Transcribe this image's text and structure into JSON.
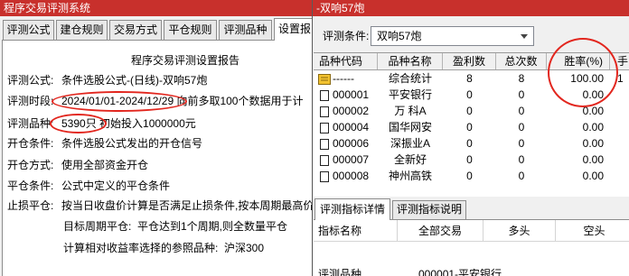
{
  "colors": {
    "title_bar": "#c8302c",
    "highlight_ring": "#e2261e",
    "folder_icon": "#f2c230"
  },
  "left_window": {
    "title": "程序交易评测系统",
    "tabs": [
      "评测公式",
      "建仓规则",
      "交易方式",
      "平仓规则",
      "评测品种",
      "设置报"
    ],
    "report": {
      "title": "程序交易评测设置报告",
      "rows": [
        {
          "label": "评测公式:",
          "value": "条件选股公式-(日线)-双响57炮"
        },
        {
          "label": "评测时段:",
          "value": "2024/01/01-2024/12/29 向前多取100个数据用于计"
        },
        {
          "label": "评测品种:",
          "value": "5390只 初始投入1000000元"
        },
        {
          "label": "开仓条件:",
          "value": "条件选股公式发出的开仓信号"
        },
        {
          "label": "开仓方式:",
          "value": "使用全部资金开仓"
        },
        {
          "label": "平仓条件:",
          "value": "公式中定义的平仓条件"
        },
        {
          "label": "止损平仓:",
          "value": "按当日收盘价计算是否满足止损条件,按本周期最高价"
        }
      ],
      "sub_rows": [
        {
          "label": "目标周期平仓:",
          "value": "平仓达到1个周期,则全数量平仓"
        },
        {
          "label": "计算相对收益率选择的参照品种:",
          "value": "沪深300"
        }
      ]
    }
  },
  "right_window": {
    "title": "-双响57炮",
    "condition_label": "评测条件:",
    "condition_value": "双响57炮",
    "table": {
      "columns": [
        "品种代码",
        "品种名称",
        "盈利数",
        "总次数",
        "胜率(%)",
        "手"
      ],
      "rows": [
        {
          "icon": "folder-icon",
          "code": "------",
          "name": "综合统计",
          "wins": "8",
          "total": "8",
          "win_rate": "100.00",
          "extra": "1"
        },
        {
          "icon": "document-icon",
          "code": "000001",
          "name": "平安银行",
          "wins": "0",
          "total": "0",
          "win_rate": "0.00"
        },
        {
          "icon": "document-icon",
          "code": "000002",
          "name": "万 科A",
          "wins": "0",
          "total": "0",
          "win_rate": "0.00"
        },
        {
          "icon": "document-icon",
          "code": "000004",
          "name": "国华网安",
          "wins": "0",
          "total": "0",
          "win_rate": "0.00"
        },
        {
          "icon": "document-icon",
          "code": "000006",
          "name": "深振业A",
          "wins": "0",
          "total": "0",
          "win_rate": "0.00"
        },
        {
          "icon": "document-icon",
          "code": "000007",
          "name": "全新好",
          "wins": "0",
          "total": "0",
          "win_rate": "0.00"
        },
        {
          "icon": "document-icon",
          "code": "000008",
          "name": "神州高铁",
          "wins": "0",
          "total": "0",
          "win_rate": "0.00"
        }
      ]
    },
    "bottom_tabs": [
      "评测指标详情",
      "评测指标说明"
    ],
    "metrics": {
      "columns": [
        "指标名称",
        "全部交易",
        "多头",
        "空头"
      ],
      "rows": [
        {
          "name": "评测品种",
          "all": "000001-平安银行"
        }
      ]
    }
  }
}
